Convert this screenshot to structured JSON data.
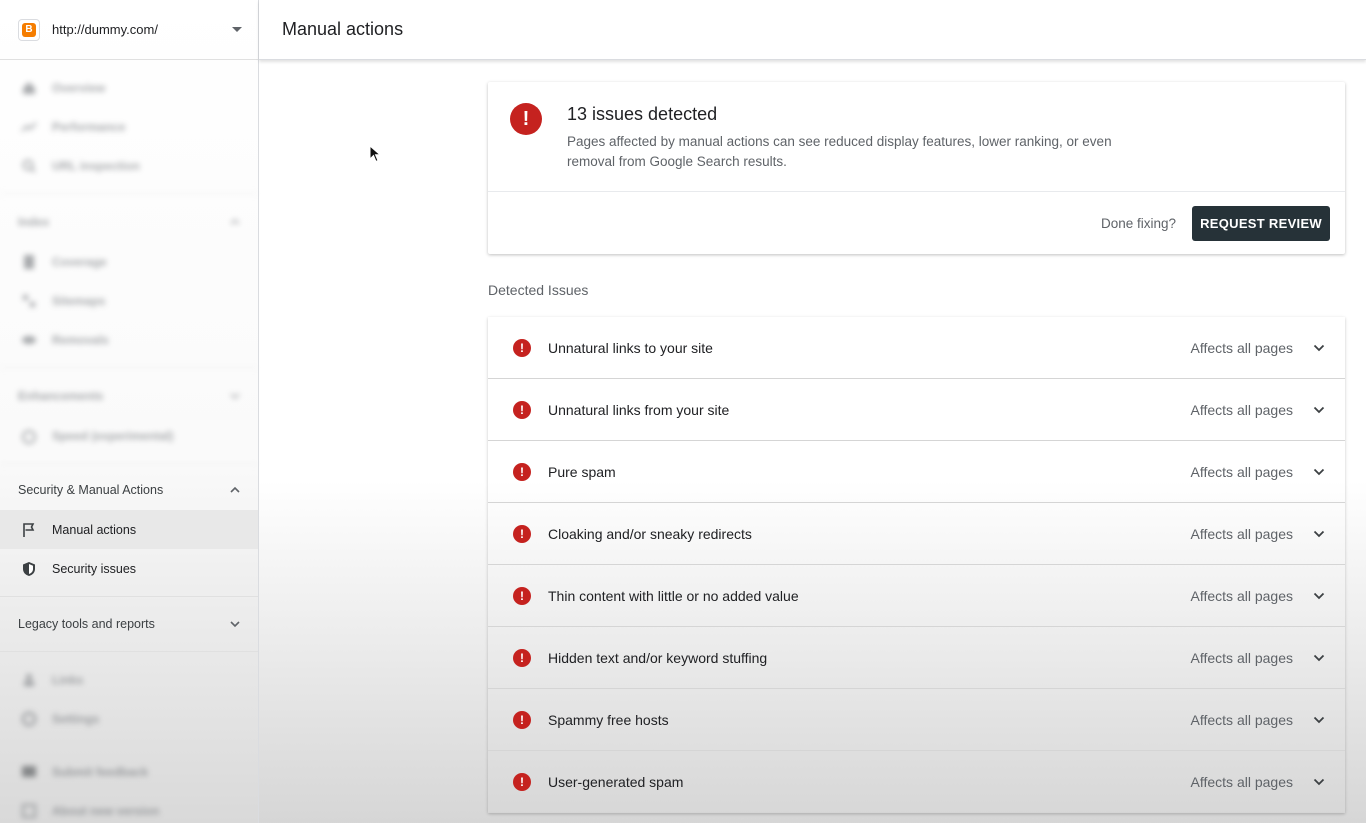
{
  "property": {
    "url": "http://dummy.com/"
  },
  "header": {
    "title": "Manual actions"
  },
  "sidebar": {
    "top_items": [
      {
        "label": "Overview",
        "icon": "home-icon"
      },
      {
        "label": "Performance",
        "icon": "trending-icon"
      },
      {
        "label": "URL inspection",
        "icon": "search-icon"
      }
    ],
    "index": {
      "title": "Index",
      "items": [
        {
          "label": "Coverage",
          "icon": "file-icon"
        },
        {
          "label": "Sitemaps",
          "icon": "sitemap-icon"
        },
        {
          "label": "Removals",
          "icon": "eye-off-icon"
        }
      ]
    },
    "enhancements": {
      "title": "Enhancements",
      "items": [
        {
          "label": "Speed (experimental)",
          "icon": "speed-icon"
        }
      ]
    },
    "security": {
      "title": "Security & Manual Actions",
      "items": [
        {
          "label": "Manual actions",
          "icon": "flag-icon"
        },
        {
          "label": "Security issues",
          "icon": "shield-icon"
        }
      ]
    },
    "legacy": {
      "title": "Legacy tools and reports"
    },
    "bottom_items": [
      {
        "label": "Links",
        "icon": "links-icon"
      },
      {
        "label": "Settings",
        "icon": "gear-icon"
      },
      {
        "label": "Submit feedback",
        "icon": "feedback-icon"
      },
      {
        "label": "About new version",
        "icon": "info-icon"
      }
    ]
  },
  "summary": {
    "title": "13 issues detected",
    "description": "Pages affected by manual actions can see reduced display features, lower ranking, or even removal from Google Search results.",
    "done_fixing": "Done fixing?",
    "review_button": "REQUEST REVIEW"
  },
  "detected_issues_label": "Detected Issues",
  "issues": [
    {
      "name": "Unnatural links to your site",
      "scope": "Affects all pages"
    },
    {
      "name": "Unnatural links from your site",
      "scope": "Affects all pages"
    },
    {
      "name": "Pure spam",
      "scope": "Affects all pages"
    },
    {
      "name": "Cloaking and/or sneaky redirects",
      "scope": "Affects all pages"
    },
    {
      "name": "Thin content with little or no added value",
      "scope": "Affects all pages"
    },
    {
      "name": "Hidden text and/or keyword stuffing",
      "scope": "Affects all pages"
    },
    {
      "name": "Spammy free hosts",
      "scope": "Affects all pages"
    },
    {
      "name": "User-generated spam",
      "scope": "Affects all pages"
    }
  ],
  "colors": {
    "alert_red": "#c5221f",
    "button_dark": "#263238",
    "blogger_orange": "#f57d00"
  }
}
